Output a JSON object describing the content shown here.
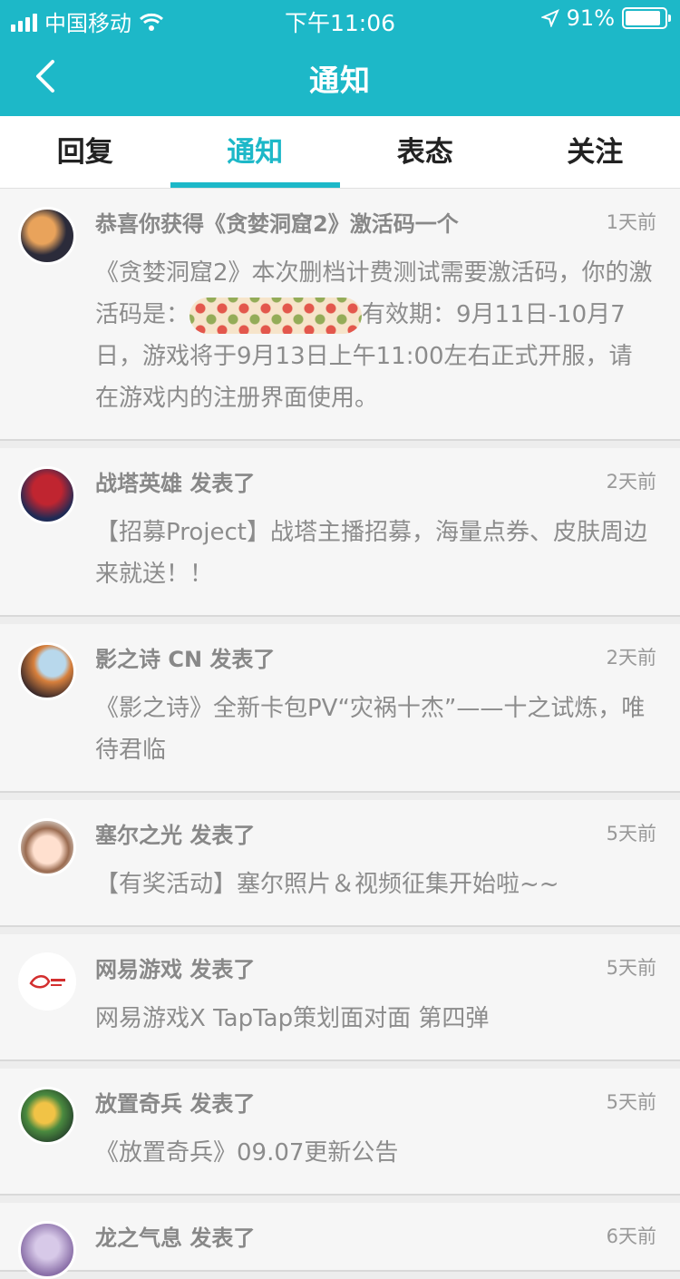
{
  "status_bar": {
    "carrier": "中国移动",
    "time": "下午11:06",
    "battery": "91%",
    "battery_level": 0.91
  },
  "nav": {
    "title": "通知"
  },
  "tabs": [
    {
      "label": "回复",
      "active": false
    },
    {
      "label": "通知",
      "active": true
    },
    {
      "label": "表态",
      "active": false
    },
    {
      "label": "关注",
      "active": false
    }
  ],
  "notifications": [
    {
      "title": "恭喜你获得《贪婪洞窟2》激活码一个",
      "time": "1天前",
      "body_a": "《贪婪洞窟2》本次删档计费测试需要激活码，你的激活码是：",
      "body_b": "有效期：9月11日-10月7日，游戏将于9月13日上午11:00左右正式开服，请在游戏内的注册界面使用。"
    },
    {
      "title": "战塔英雄 发表了",
      "time": "2天前",
      "body": "【招募Project】战塔主播招募，海量点券、皮肤周边来就送！！"
    },
    {
      "title": "影之诗 CN 发表了",
      "time": "2天前",
      "body": "《影之诗》全新卡包PV“灾祸十杰”——十之试炼，唯待君临"
    },
    {
      "title": "塞尔之光 发表了",
      "time": "5天前",
      "body": "【有奖活动】塞尔照片＆视频征集开始啦~~"
    },
    {
      "title": "网易游戏 发表了",
      "time": "5天前",
      "body": "网易游戏X TapTap策划面对面 第四弹"
    },
    {
      "title": "放置奇兵 发表了",
      "time": "5天前",
      "body": "《放置奇兵》09.07更新公告"
    },
    {
      "title": "龙之气息 发表了",
      "time": "6天前",
      "body": ""
    }
  ],
  "colors": {
    "accent": "#1db8c8"
  }
}
